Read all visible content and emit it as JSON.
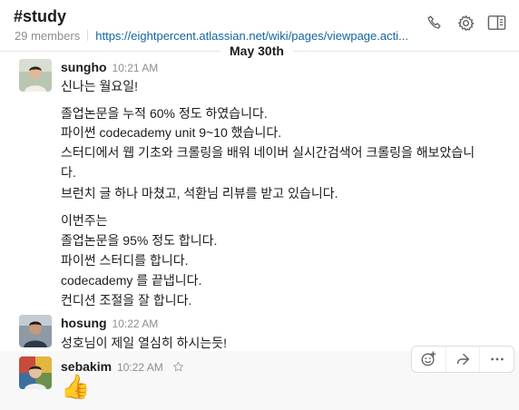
{
  "header": {
    "channel": "#study",
    "members": "29 members",
    "link": "https://eightpercent.atlassian.net/wiki/pages/viewpage.acti...",
    "icons": [
      "phone-icon",
      "gear-icon",
      "sidebar-panel-icon"
    ]
  },
  "date_divider": "May 30th",
  "messages": [
    {
      "author": "sungho",
      "time": "10:21 AM",
      "lines": [
        "신나는 월요일!",
        "졸업논문을 누적 60% 정도 하였습니다.",
        "파이썬 codecademy unit 9~10 했습니다.",
        "스터디에서 웹 기초와 크롤링을 배워 네이버 실시간검색어 크롤링을 해보았습니",
        "다.",
        "브런치 글 하나 마쳤고, 석환님 리뷰를 받고 있습니다.",
        "이번주는",
        "졸업논문을 95% 정도 합니다.",
        "파이썬 스터디를 합니다.",
        "codecademy 를 끝냅니다.",
        "컨디션 조절을 잘 합니다."
      ]
    },
    {
      "author": "hosung",
      "time": "10:22 AM",
      "lines": [
        "성호님이 제일 열심히 하시는듯!"
      ]
    },
    {
      "author": "sebakim",
      "time": "10:22 AM",
      "lines": [
        "👍"
      ]
    }
  ],
  "message_actions": [
    "add-reaction-icon",
    "share-icon",
    "more-icon"
  ]
}
